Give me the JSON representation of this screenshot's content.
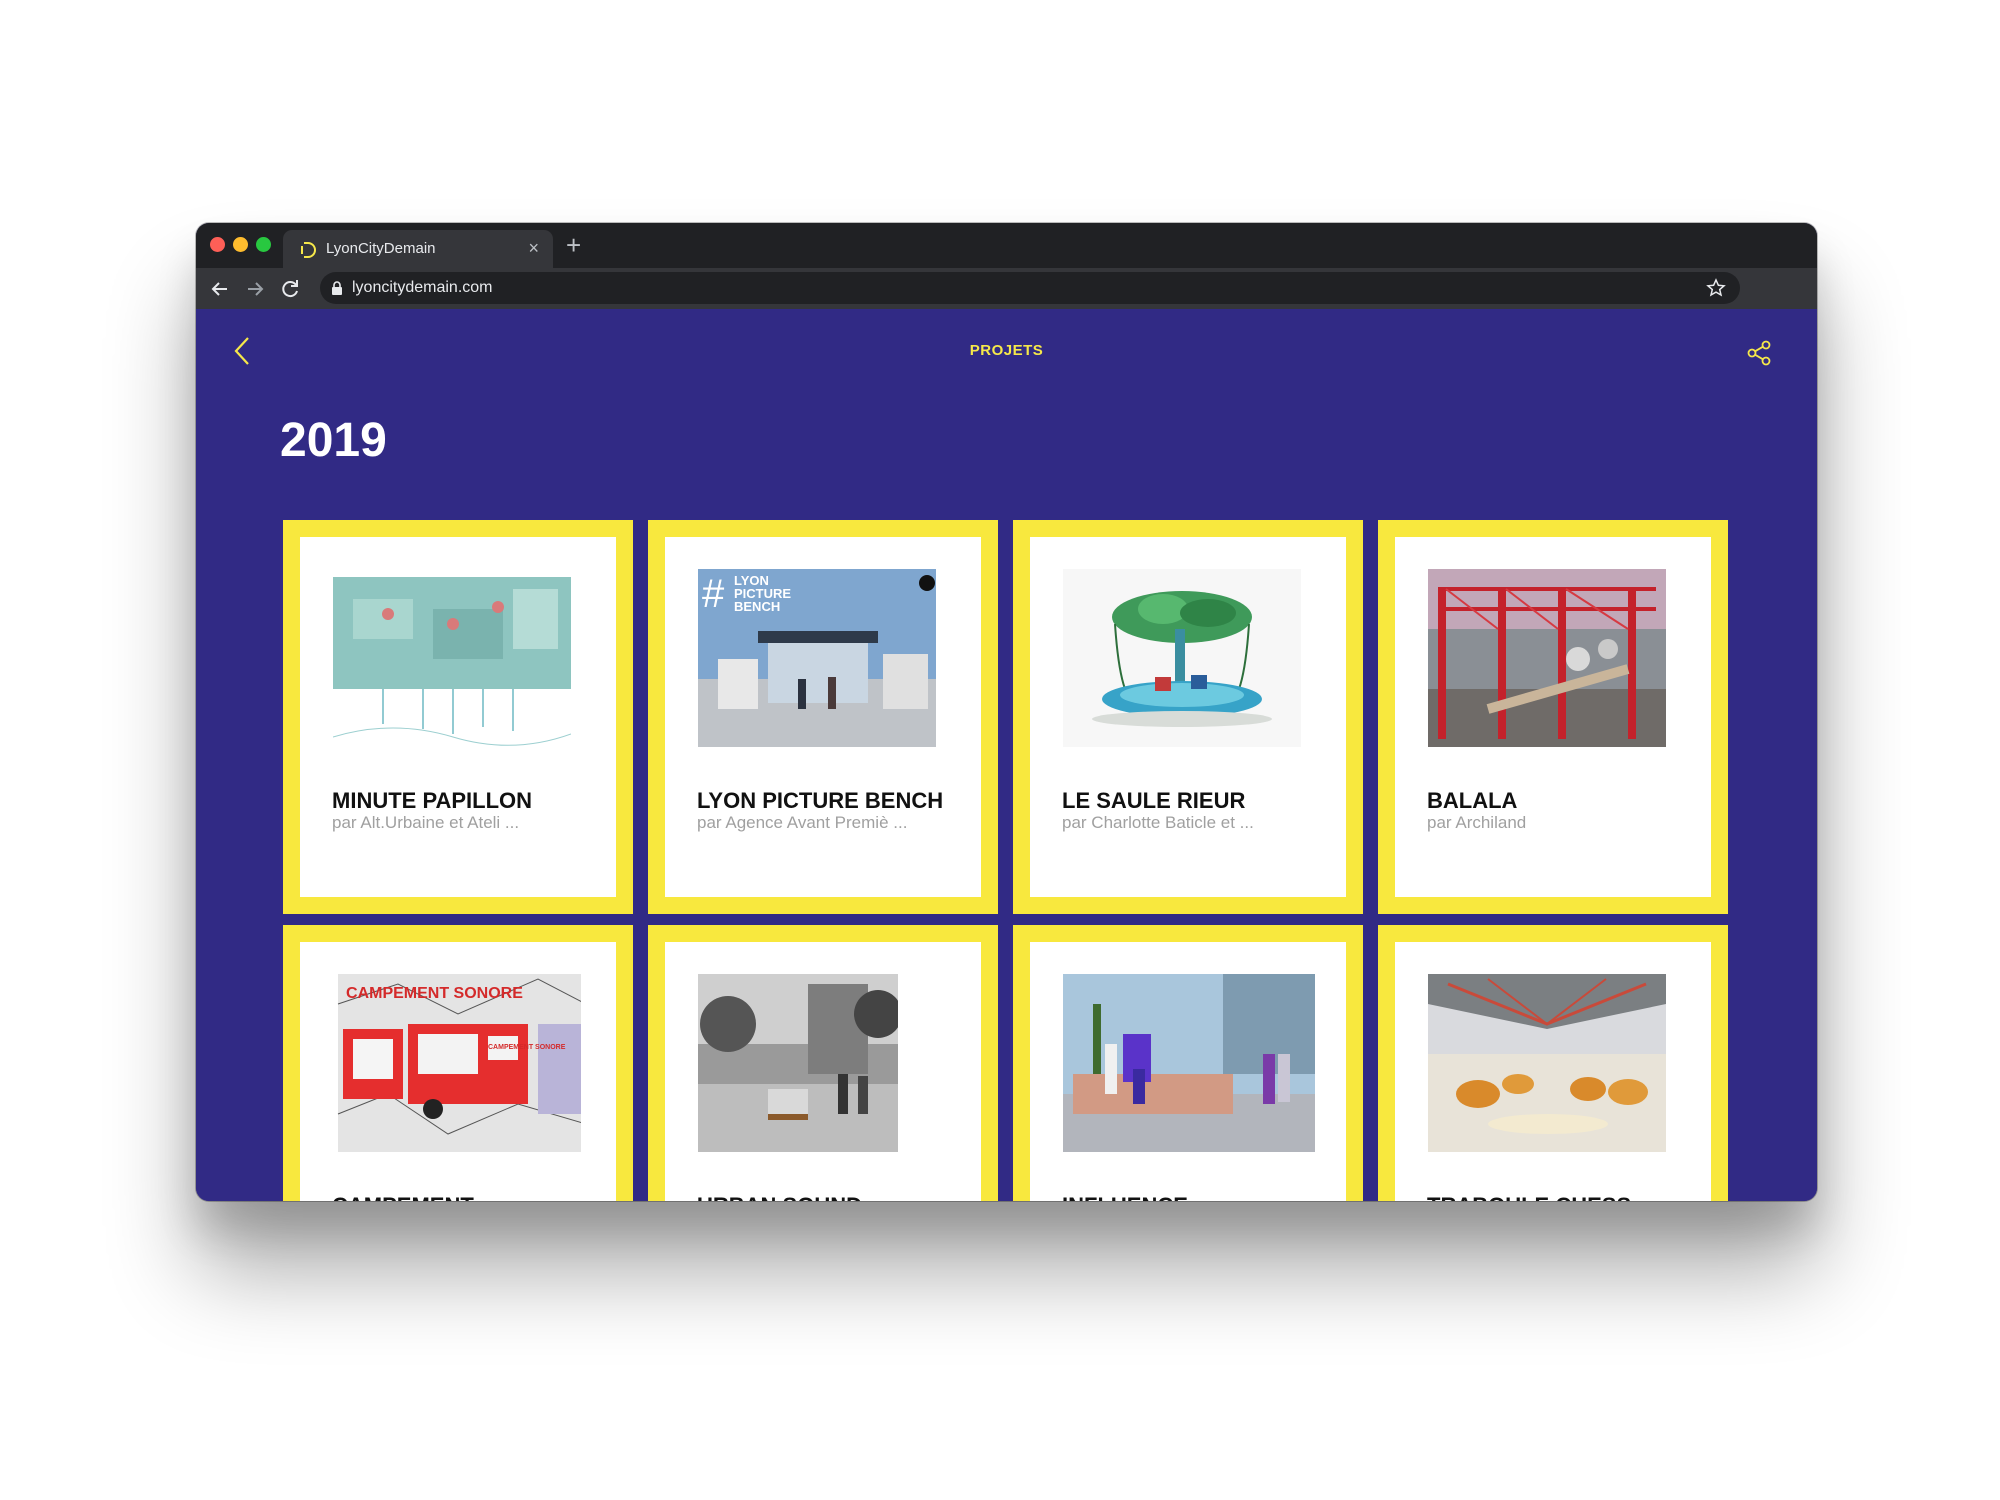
{
  "browser": {
    "tab_title": "LyonCityDemain",
    "url": "lyoncitydemain.com",
    "new_tab_label": "+",
    "tab_close_label": "×"
  },
  "page": {
    "title": "PROJETS",
    "year": "2019"
  },
  "projects": [
    {
      "title": "MINUTE PAPILLON",
      "subtitle": "par Alt.Urbaine et Ateli ..."
    },
    {
      "title": "LYON PICTURE BENCH",
      "subtitle": "par Agence Avant Premiè ..."
    },
    {
      "title": "LE SAULE RIEUR",
      "subtitle": "par Charlotte Baticle et ..."
    },
    {
      "title": "BALALA",
      "subtitle": "par Archiland"
    },
    {
      "title": "CAMPEMENT",
      "subtitle": ""
    },
    {
      "title": "URBAN SOUND",
      "subtitle": ""
    },
    {
      "title": "INFLUENCE",
      "subtitle": ""
    },
    {
      "title": "TRABOULE CHESS",
      "subtitle": ""
    }
  ],
  "thumb_texts": {
    "bench_label_1": "LYON",
    "bench_label_2": "PICTURE",
    "bench_label_3": "BENCH",
    "bench_hash": "#",
    "campement_label": "CAMPEMENT SONORE",
    "campement_tag": "CAMPEMENT SONORE"
  },
  "colors": {
    "background": "#312a85",
    "accent": "#f8e83e",
    "title_color": "#f6e84a"
  }
}
